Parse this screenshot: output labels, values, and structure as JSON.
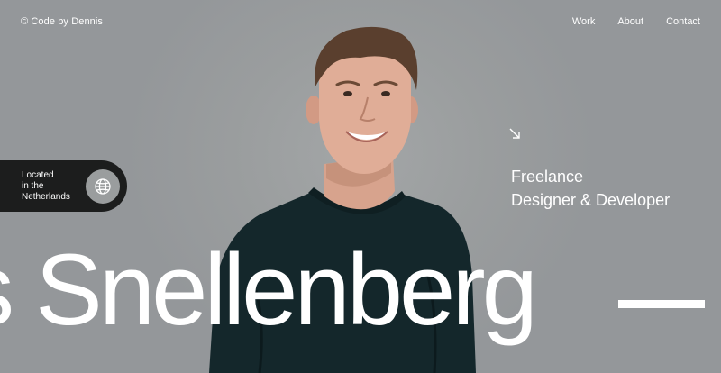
{
  "header": {
    "brand": "© Code by Dennis",
    "nav": [
      {
        "label": "Work"
      },
      {
        "label": "About"
      },
      {
        "label": "Contact"
      }
    ]
  },
  "location": {
    "lines": [
      "Located",
      "in the",
      "Netherlands"
    ],
    "icon": "globe-icon"
  },
  "role": {
    "arrow_icon": "arrow-down-right-icon",
    "line1": "Freelance",
    "line2": "Designer & Developer"
  },
  "hero": {
    "name_marquee": "s Snellenberg"
  },
  "colors": {
    "background": "#989b9c",
    "pill": "#1c1d1d",
    "sweater": "#14272b",
    "text": "#ffffff"
  }
}
